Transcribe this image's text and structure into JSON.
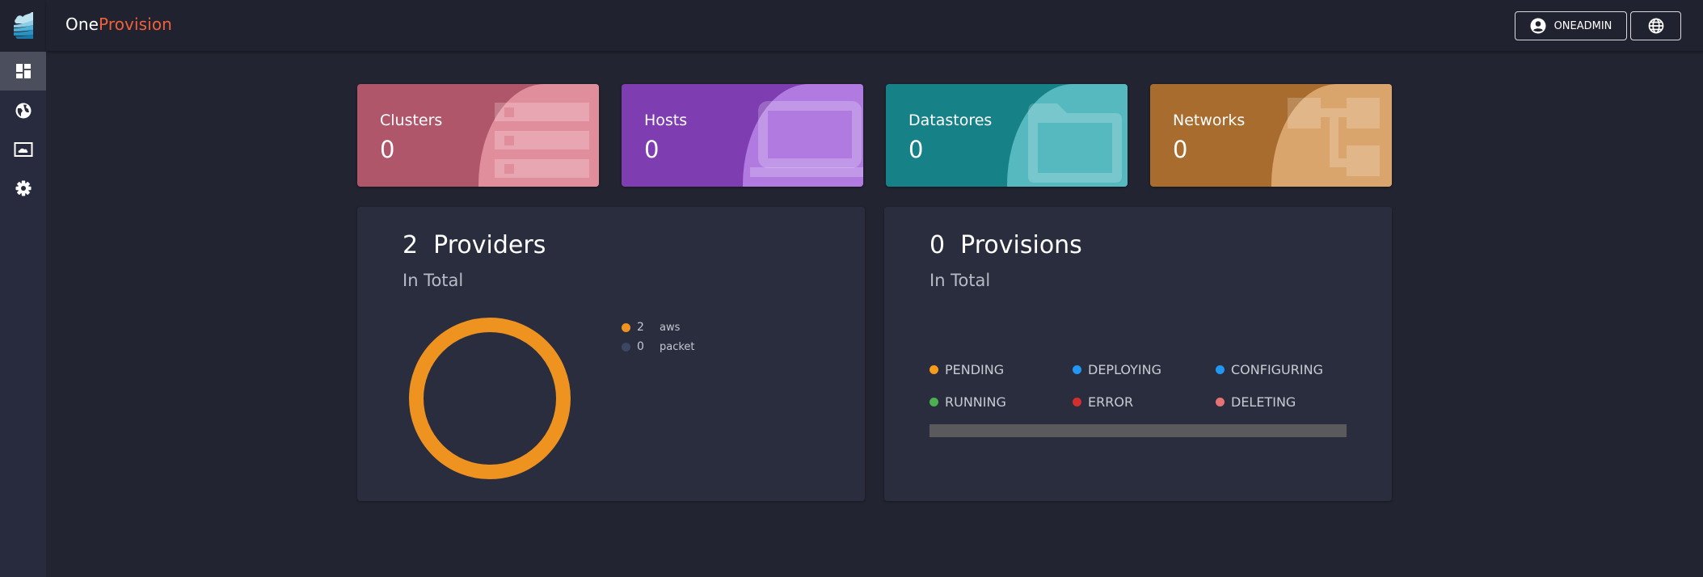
{
  "app": {
    "title_prefix": "One",
    "title_suffix": "Provision",
    "accent_color": "#f0603b"
  },
  "sidebar": {
    "items": [
      {
        "name": "dashboard",
        "icon": "dashboard-icon",
        "active": true
      },
      {
        "name": "providers",
        "icon": "globe-icon",
        "active": false
      },
      {
        "name": "provisions",
        "icon": "cloud-image-icon",
        "active": false
      },
      {
        "name": "settings",
        "icon": "gear-icon",
        "active": false
      }
    ]
  },
  "header": {
    "user_label": "ONEADMIN",
    "user_icon": "account-circle-icon",
    "language_icon": "globe-icon"
  },
  "summary_cards": [
    {
      "title": "Clusters",
      "count": "0",
      "icon": "server-list-icon",
      "color": "#b0566a",
      "overlay_color": "#e08d9c"
    },
    {
      "title": "Hosts",
      "count": "0",
      "icon": "laptop-icon",
      "color": "#7e3db1",
      "overlay_color": "#b07ae0"
    },
    {
      "title": "Datastores",
      "count": "0",
      "icon": "folder-icon",
      "color": "#168287",
      "overlay_color": "#57b9c0"
    },
    {
      "title": "Networks",
      "count": "0",
      "icon": "network-icon",
      "color": "#a86c2f",
      "overlay_color": "#daa56d"
    }
  ],
  "providers_panel": {
    "total": "2",
    "label": "Providers",
    "subtitle": "In Total"
  },
  "provisions_panel": {
    "total": "0",
    "label": "Provisions",
    "subtitle": "In Total",
    "statuses": [
      {
        "label": "PENDING",
        "color": "#f89b1a"
      },
      {
        "label": "DEPLOYING",
        "color": "#2196f3"
      },
      {
        "label": "CONFIGURING",
        "color": "#2196f3"
      },
      {
        "label": "RUNNING",
        "color": "#4caf50"
      },
      {
        "label": "ERROR",
        "color": "#d32f2f"
      },
      {
        "label": "DELETING",
        "color": "#e57373"
      }
    ],
    "bar_empty_color": "#5a5a5c"
  },
  "chart_data": {
    "type": "pie",
    "title": "2 Providers",
    "subtitle": "In Total",
    "categories": [
      "aws",
      "packet"
    ],
    "values": [
      2,
      0
    ],
    "colors": [
      "#ee9220",
      "#3b4663"
    ],
    "donut": true,
    "legend": "right"
  }
}
